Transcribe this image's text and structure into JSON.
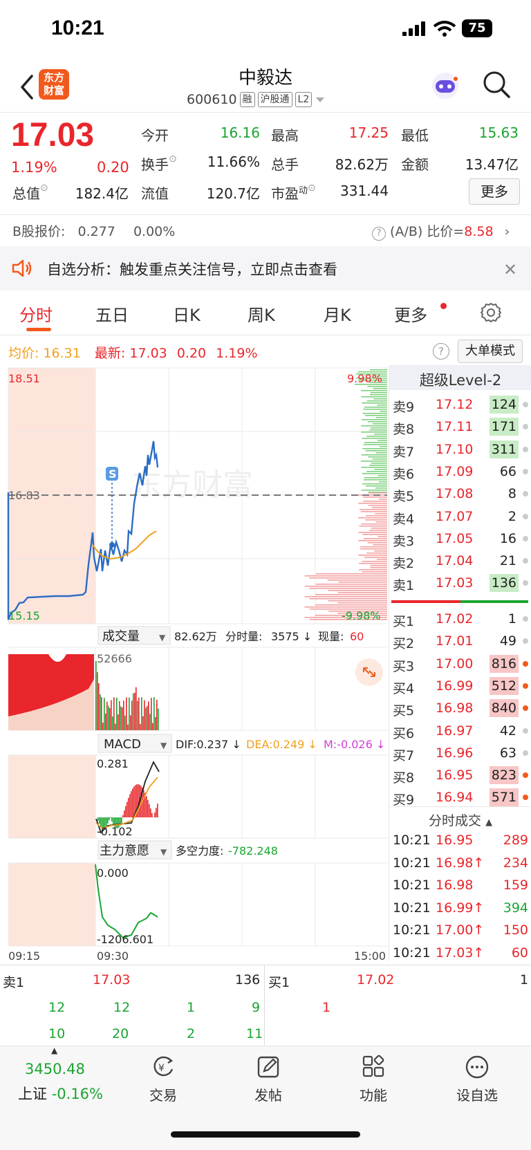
{
  "status_bar": {
    "time": "10:21",
    "battery": "75"
  },
  "header": {
    "logo_text_line1": "东方",
    "logo_text_line2": "财富",
    "stock_name": "中毅达",
    "stock_code": "600610",
    "tags": [
      "融",
      "沪股通",
      "L2"
    ]
  },
  "quote": {
    "price": "17.03",
    "change_pct": "1.19%",
    "change": "0.20",
    "fields": [
      {
        "label": "今开",
        "value": "16.16",
        "color": "green"
      },
      {
        "label": "最高",
        "value": "17.25",
        "color": "red"
      },
      {
        "label": "最低",
        "value": "15.63",
        "color": "green"
      },
      {
        "label": "换手",
        "value": "11.66%",
        "color": "black"
      },
      {
        "label": "总手",
        "value": "82.62万",
        "color": "black"
      },
      {
        "label": "金额",
        "value": "13.47亿",
        "color": "black"
      },
      {
        "label": "总值",
        "value": "182.4亿",
        "color": "black"
      },
      {
        "label": "流值",
        "value": "120.7亿",
        "color": "black"
      },
      {
        "label": "市盈",
        "label_sup": "动",
        "value": "331.44",
        "color": "black"
      }
    ],
    "more_label": "更多"
  },
  "b_share": {
    "label": "B股报价:",
    "price": "0.277",
    "pct": "0.00%",
    "ab_label": "(A/B) 比价=",
    "ab_value": "8.58"
  },
  "banner": {
    "text": "自选分析：触发重点关注信号，立即点击查看"
  },
  "tabs": [
    "分时",
    "五日",
    "日K",
    "周K",
    "月K",
    "更多"
  ],
  "avg_row": {
    "avg_label": "均价:",
    "avg_value": "16.31",
    "latest_label": "最新:",
    "latest_value": "17.03",
    "change": "0.20",
    "pct": "1.19%",
    "bigorder_label": "大单模式"
  },
  "chart_labels": {
    "price_high": "18.51",
    "price_mid": "16.83",
    "price_low": "15.15",
    "pct_high": "9.98%",
    "pct_low": "-9.98%",
    "watermark": "东方财富",
    "signal_badge": "S",
    "vol_selector": "成交量",
    "vol_info_total": "82.62万",
    "vol_info_minute_label": "分时量:",
    "vol_info_minute_value": "3575 ↓",
    "vol_info_now_label": "现量:",
    "vol_info_now_value": "60",
    "vol_max": "52666",
    "macd_selector": "MACD",
    "dif": "DIF:0.237 ↓",
    "dea": "DEA:0.249 ↓",
    "m": "M:-0.026 ↓",
    "macd_max": "0.281",
    "macd_min": "-0.102",
    "main_selector": "主力意愿",
    "force_label": "多空力度:",
    "force_value": "-782.248",
    "main_max": "0.000",
    "main_min": "-1206.601",
    "time_start": "09:15",
    "time_open": "09:30",
    "time_end": "15:00"
  },
  "chart_data": {
    "type": "line",
    "title": "",
    "xlabel": "",
    "ylabel": "",
    "ylim": [
      15.15,
      18.51
    ],
    "x_ticks": [
      "09:15",
      "09:30",
      "15:00"
    ],
    "series": [
      {
        "name": "最新",
        "color": "#2b6cc4"
      },
      {
        "name": "均价",
        "color": "#f0a020"
      }
    ],
    "reference_price": 16.83
  },
  "level2": {
    "title": "超级Level-2",
    "asks": [
      {
        "label": "卖9",
        "price": "17.12",
        "vol": "124"
      },
      {
        "label": "卖8",
        "price": "17.11",
        "vol": "171"
      },
      {
        "label": "卖7",
        "price": "17.10",
        "vol": "311"
      },
      {
        "label": "卖6",
        "price": "17.09",
        "vol": "66"
      },
      {
        "label": "卖5",
        "price": "17.08",
        "vol": "8"
      },
      {
        "label": "卖4",
        "price": "17.07",
        "vol": "2"
      },
      {
        "label": "卖3",
        "price": "17.05",
        "vol": "16"
      },
      {
        "label": "卖2",
        "price": "17.04",
        "vol": "21"
      },
      {
        "label": "卖1",
        "price": "17.03",
        "vol": "136"
      }
    ],
    "bids": [
      {
        "label": "买1",
        "price": "17.02",
        "vol": "1"
      },
      {
        "label": "买2",
        "price": "17.01",
        "vol": "49"
      },
      {
        "label": "买3",
        "price": "17.00",
        "vol": "816"
      },
      {
        "label": "买4",
        "price": "16.99",
        "vol": "512"
      },
      {
        "label": "买5",
        "price": "16.98",
        "vol": "840"
      },
      {
        "label": "买6",
        "price": "16.97",
        "vol": "42"
      },
      {
        "label": "买7",
        "price": "16.96",
        "vol": "63"
      },
      {
        "label": "买8",
        "price": "16.95",
        "vol": "823"
      },
      {
        "label": "买9",
        "price": "16.94",
        "vol": "571"
      }
    ],
    "trades_title": "分时成交",
    "trades": [
      {
        "time": "10:21",
        "price": "16.95",
        "vol": "289",
        "color": "red"
      },
      {
        "time": "10:21",
        "price": "16.98↑",
        "vol": "234",
        "color": "red"
      },
      {
        "time": "10:21",
        "price": "16.98",
        "vol": "159",
        "color": "red"
      },
      {
        "time": "10:21",
        "price": "16.99↑",
        "vol": "394",
        "color": "green"
      },
      {
        "time": "10:21",
        "price": "17.00↑",
        "vol": "150",
        "color": "red"
      },
      {
        "time": "10:21",
        "price": "17.03↑",
        "vol": "60",
        "color": "red"
      }
    ]
  },
  "book_bottom": {
    "sell_label": "卖1",
    "sell_price": "17.03",
    "sell_vol": "136",
    "buy_label": "买1",
    "buy_price": "17.02",
    "buy_vol": "1",
    "sell_row1": [
      "12",
      "12",
      "1",
      "9"
    ],
    "sell_row2": [
      "10",
      "20",
      "2",
      "11"
    ],
    "buy_row1": [
      "1"
    ]
  },
  "footer": {
    "index_value": "3450.48",
    "index_name": "上证",
    "index_pct": "-0.16%",
    "nav": [
      "交易",
      "发帖",
      "功能",
      "设自选"
    ]
  }
}
